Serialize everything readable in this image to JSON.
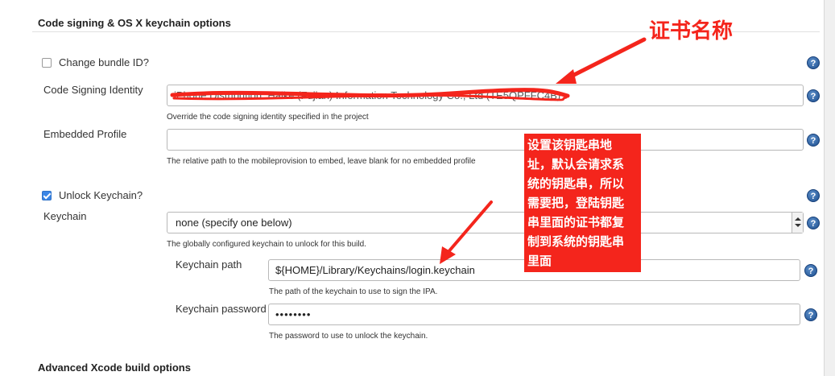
{
  "sections": {
    "code_signing_title": "Code signing & OS X keychain options",
    "advanced_title": "Advanced Xcode build options"
  },
  "change_bundle": {
    "label": "Change bundle ID?",
    "checked": false
  },
  "signing_identity": {
    "label": "Code Signing Identity",
    "value": "iPhone Distribution: Haike (Fujian) Information Technology Co., Ltd (TE5QPFFC4B)",
    "hint": "Override the code signing identity specified in the project"
  },
  "embedded_profile": {
    "label": "Embedded Profile",
    "value": "",
    "hint": "The relative path to the mobileprovision to embed, leave blank for no embedded profile"
  },
  "unlock_keychain": {
    "label": "Unlock Keychain?",
    "checked": true
  },
  "keychain": {
    "label": "Keychain",
    "selected": "none (specify one below)",
    "hint": "The globally configured keychain to unlock for this build."
  },
  "keychain_path": {
    "label": "Keychain path",
    "value": "${HOME}/Library/Keychains/login.keychain",
    "hint": "The path of the keychain to use to sign the IPA."
  },
  "keychain_password": {
    "label": "Keychain password",
    "value": "••••••••",
    "hint": "The password to use to unlock the keychain."
  },
  "help_glyph": "?",
  "annotations": {
    "cert_name": "证书名称",
    "keychain_note_lines": [
      "设置该钥匙串地",
      "址，默认会请求系",
      "统的钥匙串，所以",
      "需要把，登陆钥匙",
      "串里面的证书都复",
      "制到系统的钥匙串",
      "里面"
    ],
    "color": "#f4251c"
  },
  "icons": {
    "help": "help-icon",
    "select_arrow": "dropdown-arrow-icon"
  }
}
